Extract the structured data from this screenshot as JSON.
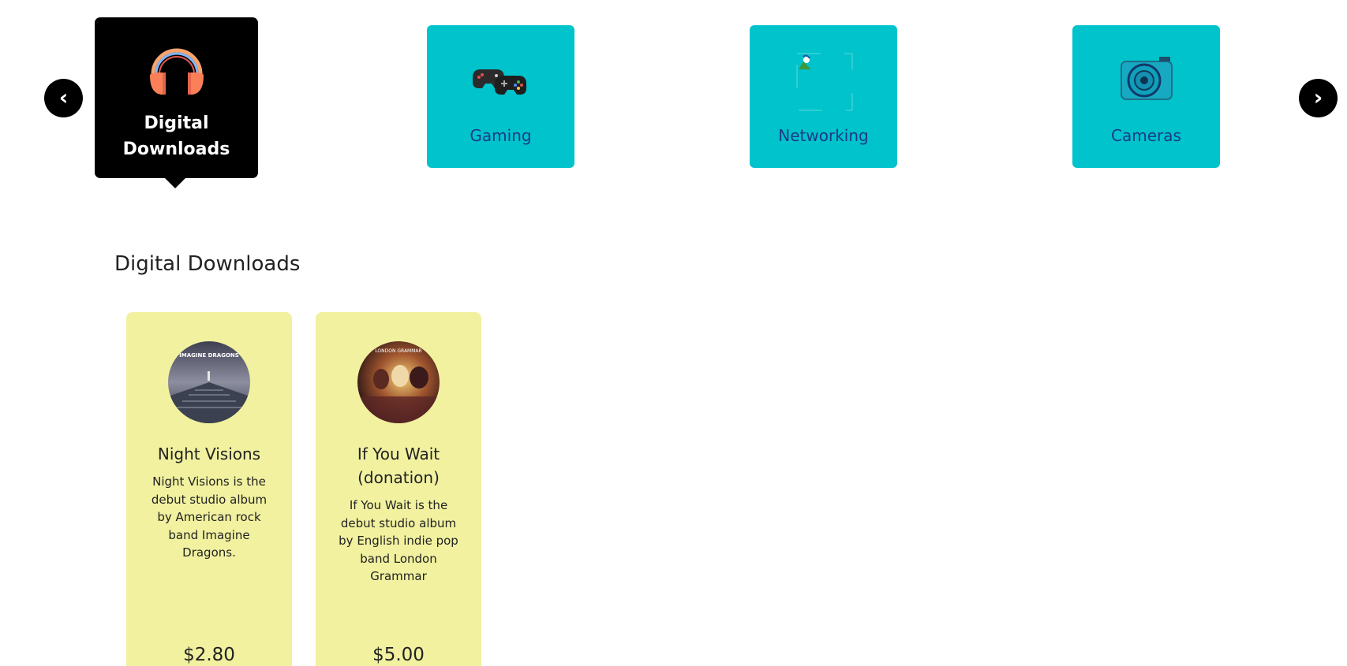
{
  "carousel": {
    "prev_label": "‹",
    "next_label": "›",
    "categories": [
      {
        "label": "Digital Downloads",
        "icon": "headphones-icon",
        "active": true
      },
      {
        "label": "Gaming",
        "icon": "game-controller-icon",
        "active": false
      },
      {
        "label": "Networking",
        "icon": "network-image-icon",
        "active": false
      },
      {
        "label": "Cameras",
        "icon": "camera-icon",
        "active": false
      }
    ]
  },
  "section": {
    "title": "Digital Downloads"
  },
  "products": [
    {
      "name": "Night Visions",
      "description": "Night Visions is the debut studio album by American rock band Imagine Dragons.",
      "price": "$2.80",
      "thumb_text": "IMAGINE DRAGONS"
    },
    {
      "name": "If You Wait (donation)",
      "description": "If You Wait is the debut studio album by English indie pop band London Grammar",
      "price": "$5.00",
      "thumb_text": "LONDON GRAMMAR"
    }
  ],
  "colors": {
    "category_bg": "#00c3cc",
    "category_active_bg": "#000000",
    "category_label": "#1b3b86",
    "card_bg": "#f1f1a0"
  }
}
